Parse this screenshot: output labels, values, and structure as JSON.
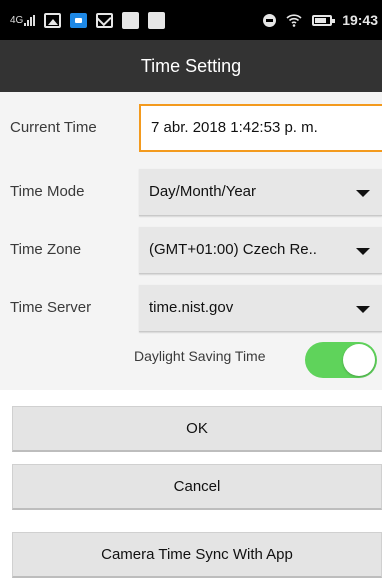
{
  "status_bar": {
    "network": "4G",
    "time": "19:43"
  },
  "header": {
    "title": "Time Setting"
  },
  "form": {
    "current_time": {
      "label": "Current Time",
      "value": "7 abr. 2018 1:42:53 p. m."
    },
    "time_mode": {
      "label": "Time Mode",
      "value": "Day/Month/Year"
    },
    "time_zone": {
      "label": "Time Zone",
      "value": "(GMT+01:00) Czech Re.."
    },
    "time_server": {
      "label": "Time Server",
      "value": "time.nist.gov"
    },
    "daylight_saving": {
      "label": "Daylight Saving Time",
      "enabled": true,
      "on_color": "#5fd35b"
    }
  },
  "buttons": {
    "ok": "OK",
    "cancel": "Cancel",
    "sync": "Camera Time Sync With App"
  },
  "colors": {
    "header_bg": "#333333",
    "field_focus_border": "#f39a1e",
    "form_bg": "#f4f4f4"
  }
}
